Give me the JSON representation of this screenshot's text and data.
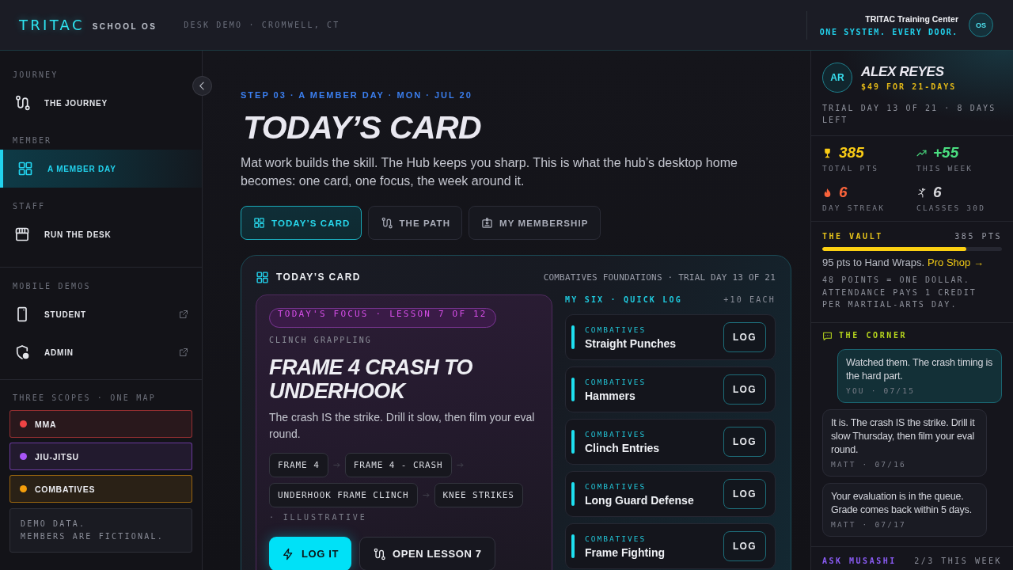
{
  "header": {
    "brand": "TRITAC",
    "product": "SCHOOL OS",
    "context": "DESK DEMO · CROMWELL, CT",
    "org_name": "TRITAC Training Center",
    "tagline": "ONE SYSTEM. EVERY DOOR.",
    "avatar_initials": "OS"
  },
  "sidebar": {
    "sections": [
      {
        "title": "JOURNEY",
        "items": [
          {
            "label": "THE JOURNEY",
            "selected": false,
            "external": false
          }
        ]
      },
      {
        "title": "MEMBER",
        "items": [
          {
            "label": "A MEMBER DAY",
            "selected": true,
            "external": false
          }
        ]
      },
      {
        "title": "STAFF",
        "items": [
          {
            "label": "RUN THE DESK",
            "selected": false,
            "external": false
          }
        ]
      },
      {
        "title": "MOBILE DEMOS",
        "items": [
          {
            "label": "STUDENT",
            "selected": false,
            "external": true
          },
          {
            "label": "ADMIN",
            "selected": false,
            "external": true
          }
        ]
      }
    ],
    "scopes": {
      "title": "THREE SCOPES · ONE MAP",
      "items": [
        {
          "label": "MMA",
          "color": "#ef4444"
        },
        {
          "label": "JIU-JITSU",
          "color": "#a855f7"
        },
        {
          "label": "COMBATIVES",
          "color": "#f59e0b"
        }
      ]
    },
    "note": "DEMO DATA.\nMEMBERS ARE FICTIONAL."
  },
  "page": {
    "eyebrow": "STEP 03 · A MEMBER DAY · MON · JUL 20",
    "title": "TODAY’S CARD",
    "intro": "Mat work builds the skill. The Hub keeps you sharp. This is what the hub’s desktop home becomes: one card, one focus, the week around it."
  },
  "tabs": [
    {
      "label": "TODAY’S CARD",
      "selected": true
    },
    {
      "label": "THE PATH",
      "selected": false
    },
    {
      "label": "MY MEMBERSHIP",
      "selected": false
    }
  ],
  "card": {
    "title": "TODAY’S CARD",
    "meta": "COMBATIVES FOUNDATIONS · TRIAL DAY 13 OF 21",
    "focus": {
      "badge": "TODAY'S FOCUS · LESSON 7 OF 12",
      "category": "CLINCH GRAPPLING",
      "title": "FRAME 4 CRASH TO UNDERHOOK",
      "description": "The crash IS the strike. Drill it slow, then film your eval round.",
      "chain": [
        "FRAME 4",
        "FRAME 4 - CRASH",
        "UNDERHOOK FRAME CLINCH",
        "KNEE STRIKES"
      ],
      "chain_note": "· ILLUSTRATIVE",
      "actions": [
        {
          "label": "LOG IT",
          "kind": "primary"
        },
        {
          "label": "OPEN LESSON 7",
          "kind": "secondary"
        }
      ]
    },
    "quick_log": {
      "title": "MY SIX · QUICK LOG",
      "bonus": "+10 EACH",
      "drills": [
        {
          "category": "COMBATIVES",
          "name": "Straight Punches",
          "action": "LOG"
        },
        {
          "category": "COMBATIVES",
          "name": "Hammers",
          "action": "LOG"
        },
        {
          "category": "COMBATIVES",
          "name": "Clinch Entries",
          "action": "LOG"
        },
        {
          "category": "COMBATIVES",
          "name": "Long Guard Defense",
          "action": "LOG"
        },
        {
          "category": "COMBATIVES",
          "name": "Frame Fighting",
          "action": "LOG"
        }
      ]
    }
  },
  "right_panel": {
    "member": {
      "initials": "AR",
      "name": "ALEX REYES",
      "plan": "$49 FOR 21-DAYS",
      "trial": "TRIAL DAY 13 OF 21 · 8 DAYS LEFT"
    },
    "stats": [
      {
        "value": "385",
        "label": "TOTAL PTS",
        "color": "#facc15"
      },
      {
        "value": "+55",
        "label": "THIS WEEK",
        "color": "#4ade80"
      },
      {
        "value": "6",
        "label": "DAY STREAK",
        "color": "#f9633b"
      },
      {
        "value": "6",
        "label": "CLASSES 30D",
        "color": "#d4d4d8"
      }
    ],
    "vault": {
      "title": "THE VAULT",
      "points": "385 PTS",
      "level": 0.8,
      "progress_text": "95 pts to Hand Wraps.",
      "link": "Pro Shop →",
      "note": "48 POINTS = ONE DOLLAR. ATTENDANCE PAYS 1 CREDIT PER MARTIAL-ARTS DAY."
    },
    "corner": {
      "title": "THE CORNER",
      "messages": [
        {
          "kind": "outgoing",
          "text": "Watched them. The crash timing is the hard part.",
          "meta": "YOU · 07/15"
        },
        {
          "kind": "incoming",
          "text": "It is. The crash IS the strike. Drill it slow Thursday, then film your eval round.",
          "meta": "MATT · 07/16"
        },
        {
          "kind": "incoming",
          "text": "Your evaluation is in the queue. Grade comes back within 5 days.",
          "meta": "MATT · 07/17"
        }
      ]
    },
    "assistant": {
      "label": "ASK MUSASHI",
      "usage": "2/3 THIS WEEK"
    }
  }
}
